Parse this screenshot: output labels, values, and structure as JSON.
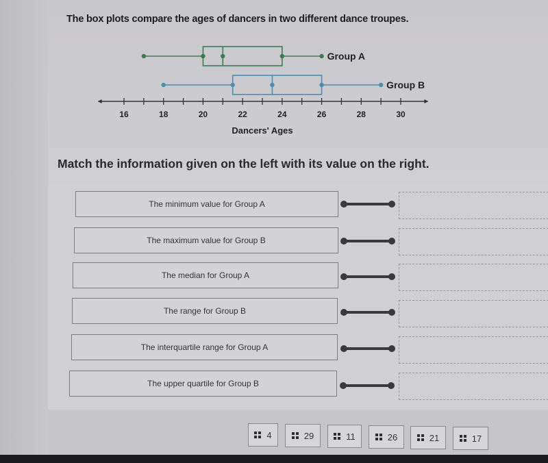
{
  "question": {
    "title": "The box plots compare the ages of dancers in two different dance troupes.",
    "instruction": "Match the information given on the left with its value on the right."
  },
  "chart_data": {
    "type": "boxplot",
    "xlabel": "Dancers' Ages",
    "xlim": [
      15.5,
      30.5
    ],
    "ticks": [
      16,
      17,
      18,
      19,
      20,
      21,
      22,
      23,
      24,
      25,
      26,
      27,
      28,
      29,
      30
    ],
    "tick_labels": [
      "16",
      "18",
      "20",
      "22",
      "24",
      "26",
      "28",
      "30"
    ],
    "tick_label_values": [
      16,
      18,
      20,
      22,
      24,
      26,
      28,
      30
    ],
    "series": [
      {
        "name": "Group A",
        "min": 17,
        "q1": 20,
        "median": 21,
        "q3": 24,
        "max": 26,
        "color": "#3f7a55"
      },
      {
        "name": "Group B",
        "min": 18,
        "q1": 21.5,
        "median": 23.5,
        "q3": 26,
        "max": 29,
        "color": "#4a8fae"
      }
    ]
  },
  "matching": {
    "prompts": [
      {
        "label": "The minimum value for Group A"
      },
      {
        "label": "The maximum value for Group B"
      },
      {
        "label": "The median for Group A"
      },
      {
        "label": "The range for Group B"
      },
      {
        "label": "The interquartile range for Group A"
      },
      {
        "label": "The upper quartile for Group B"
      }
    ],
    "answer_tiles": [
      {
        "value": "4"
      },
      {
        "value": "29"
      },
      {
        "value": "11"
      },
      {
        "value": "26"
      },
      {
        "value": "21"
      },
      {
        "value": "17"
      }
    ]
  }
}
